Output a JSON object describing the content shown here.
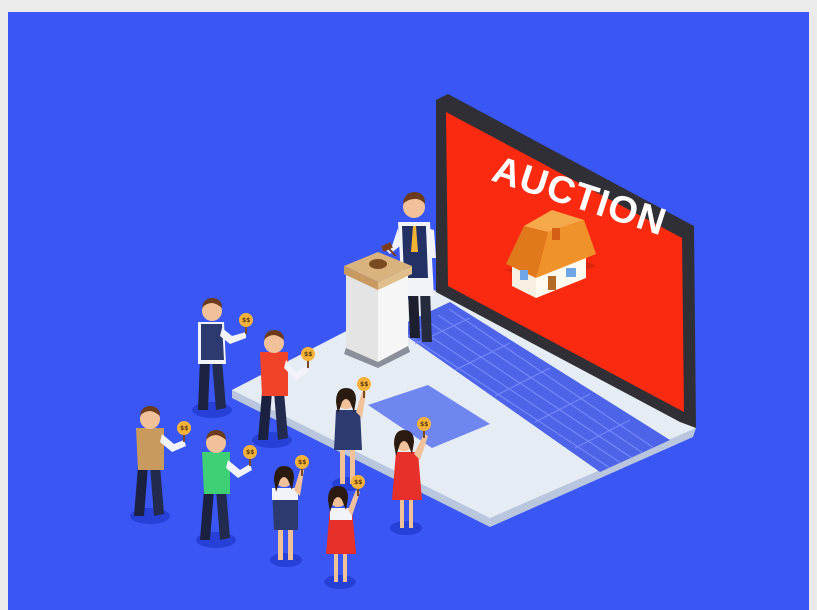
{
  "illustration": {
    "screen_title": "AUCTION",
    "paddle_label": "$$",
    "colors": {
      "background": "#3a57f5",
      "frame": "#ebebeb",
      "screen": "#fa2a10",
      "laptop_body": "#e6ecf4",
      "keyboard": "#4d63e8",
      "bezel": "#2f2f35",
      "house_roof": "#f0922a",
      "paddle": "#f5b23a"
    },
    "icons": [
      "laptop-icon",
      "house-icon",
      "podium-icon",
      "gavel-icon",
      "bid-paddle-icon"
    ]
  }
}
